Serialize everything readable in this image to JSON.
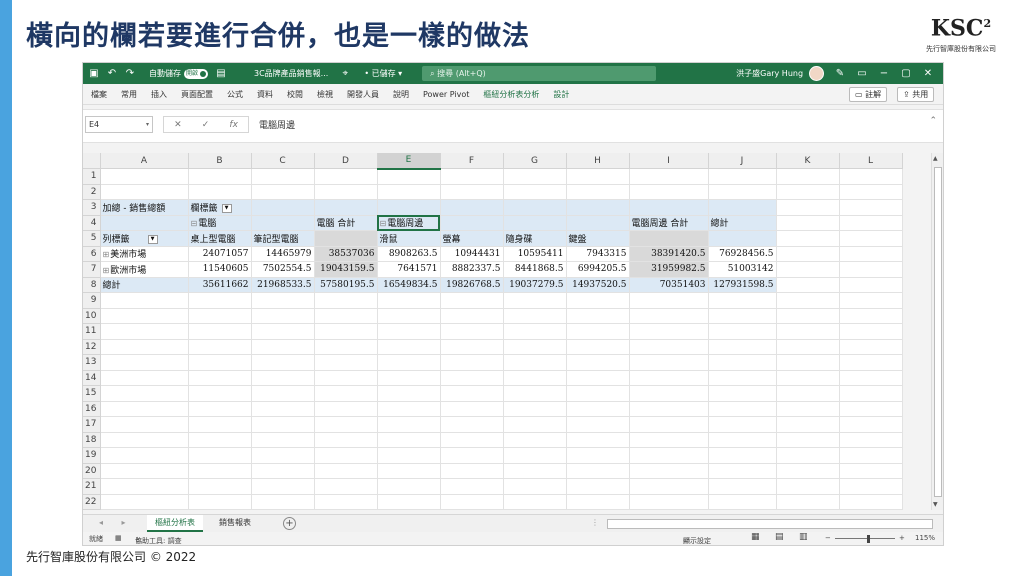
{
  "slide": {
    "title": "橫向的欄若要進行合併，也是一樣的做法",
    "logo_text": "KSC",
    "logo_sup": "2",
    "logo_subtitle": "先行智庫股份有限公司",
    "footer": "先行智庫股份有限公司 © 2022"
  },
  "titlebar": {
    "autosave_label": "自動儲存",
    "autosave_state": "開啟",
    "filename": "3C品牌產品銷售報...",
    "saved_status": "• 已儲存 ▾",
    "search_placeholder": "搜尋 (Alt+Q)",
    "user_name": "洪子盛Gary Hung"
  },
  "ribbon": {
    "tabs": [
      "檔案",
      "常用",
      "插入",
      "頁面配置",
      "公式",
      "資料",
      "校閱",
      "檢視",
      "開發人員",
      "說明",
      "Power Pivot",
      "樞紐分析表分析",
      "設計"
    ],
    "comment_btn": "註解",
    "share_btn": "共用"
  },
  "formula_bar": {
    "cell_ref": "E4",
    "formula": "電腦周邊"
  },
  "grid": {
    "columns": [
      "A",
      "B",
      "C",
      "D",
      "E",
      "F",
      "G",
      "H",
      "I",
      "J",
      "K",
      "L"
    ],
    "active_column": "E",
    "row_numbers": [
      "1",
      "2",
      "3",
      "4",
      "5",
      "6",
      "7",
      "8",
      "9",
      "10",
      "11",
      "12",
      "13",
      "14",
      "15",
      "16",
      "17",
      "18",
      "19",
      "20",
      "21",
      "22"
    ],
    "pivot": {
      "r3": {
        "a": "加總 - 銷售總額",
        "b": "欄標籤"
      },
      "r4": {
        "b": "電腦",
        "d": "電腦 合計",
        "e": "電腦周邊",
        "i": "電腦周邊 合計",
        "j": "總計"
      },
      "r5": {
        "a": "列標籤",
        "b": "桌上型電腦",
        "c": "筆記型電腦",
        "e": "滑鼠",
        "f": "螢幕",
        "g": "隨身碟",
        "h": "鍵盤"
      },
      "r6": {
        "a": "美洲市場",
        "b": "24071057",
        "c": "14465979",
        "d": "38537036",
        "e": "8908263.5",
        "f": "10944431",
        "g": "10595411",
        "h": "7943315",
        "i": "38391420.5",
        "j": "76928456.5"
      },
      "r7": {
        "a": "歐洲市場",
        "b": "11540605",
        "c": "7502554.5",
        "d": "19043159.5",
        "e": "7641571",
        "f": "8882337.5",
        "g": "8441868.5",
        "h": "6994205.5",
        "i": "31959982.5",
        "j": "51003142"
      },
      "r8": {
        "a": "總計",
        "b": "35611662",
        "c": "21968533.5",
        "d": "57580195.5",
        "e": "16549834.5",
        "f": "19826768.5",
        "g": "19037279.5",
        "h": "14937520.5",
        "i": "70351403",
        "j": "127931598.5"
      }
    }
  },
  "sheets": {
    "tabs": [
      "樞紐分析表",
      "銷售報表"
    ],
    "active": "樞紐分析表"
  },
  "status": {
    "ready": "就緒",
    "accessibility": "協助工具: 調查",
    "display_settings": "顯示設定",
    "zoom_minus": "−",
    "zoom_plus": "+",
    "zoom": "115%"
  },
  "colors": {
    "excel_green": "#217346",
    "pivot_blue": "#dce9f5",
    "pivot_gray": "#d9d9d9",
    "slide_title": "#1f3864",
    "slide_accent": "#4aa3df"
  }
}
